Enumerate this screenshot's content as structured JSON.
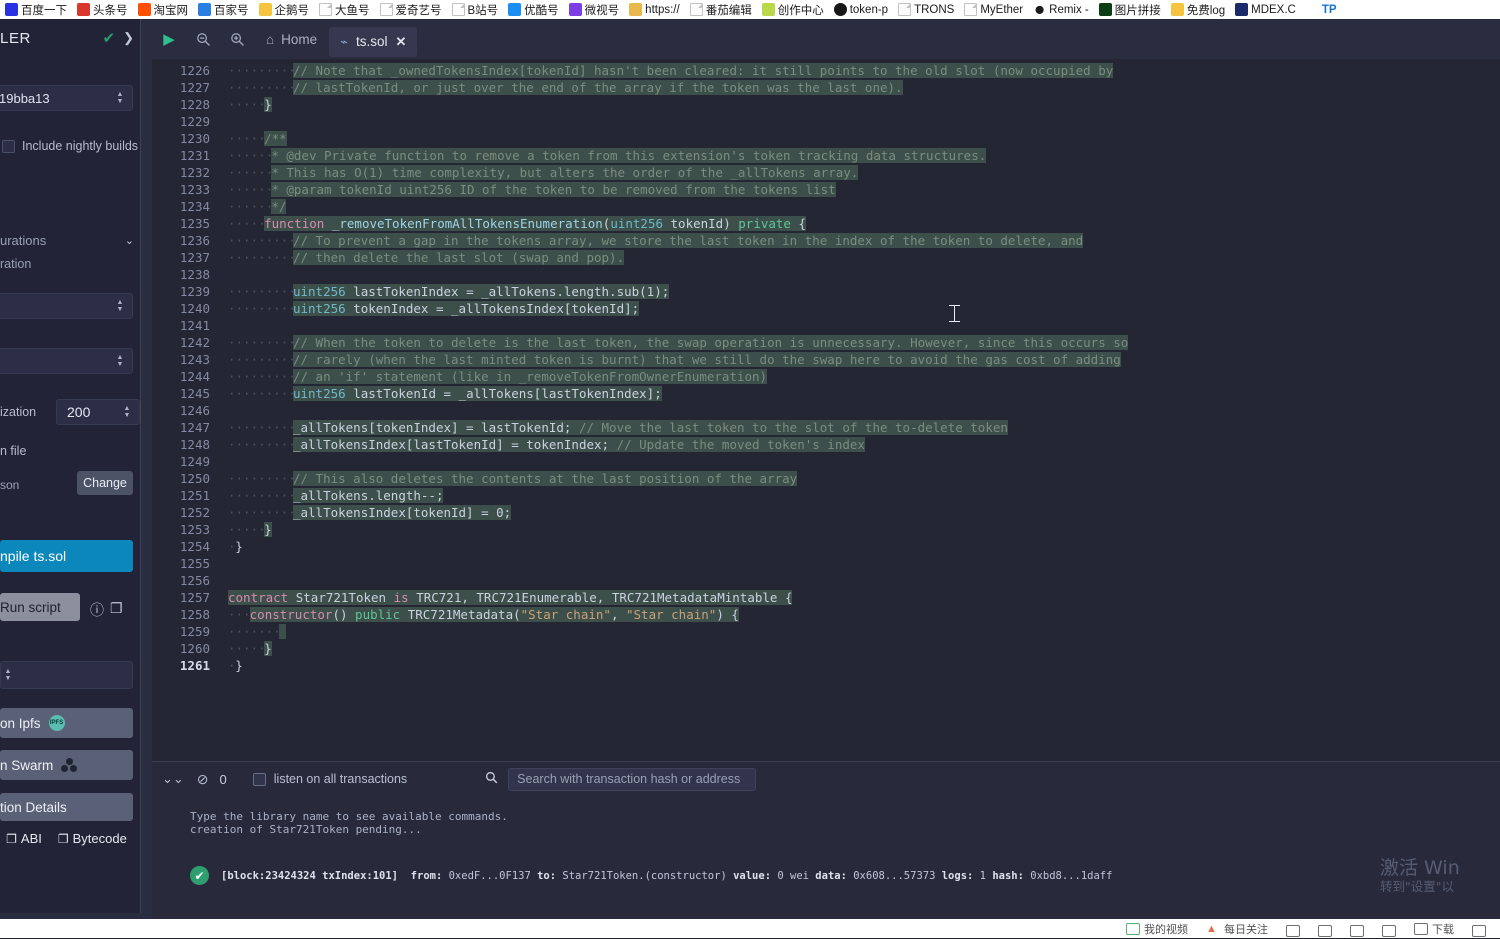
{
  "browser": {
    "bookmarks": [
      {
        "label": "百度一下",
        "icon": "baidu-icon",
        "color": "#2932e1"
      },
      {
        "label": "头条号",
        "icon": "toutiao-icon",
        "color": "#d9372b"
      },
      {
        "label": "淘宝网",
        "icon": "taobao-icon",
        "color": "#ff5000"
      },
      {
        "label": "百家号",
        "icon": "baijiahao-icon",
        "color": "#2b7fe0"
      },
      {
        "label": "企鹅号",
        "icon": "qiehao-icon",
        "color": "#f5c542"
      },
      {
        "label": "大鱼号",
        "icon": "page-icon",
        "color": "#ffffff"
      },
      {
        "label": "爱奇艺号",
        "icon": "page-icon",
        "color": "#ffffff"
      },
      {
        "label": "B站号",
        "icon": "page-icon",
        "color": "#ffffff"
      },
      {
        "label": "优酷号",
        "icon": "youku-icon",
        "color": "#1b8ef2"
      },
      {
        "label": "微视号",
        "icon": "weishi-icon",
        "color": "#7b3fe4"
      },
      {
        "label": "https://",
        "icon": "folder-icon",
        "color": "#e8b84b"
      },
      {
        "label": "番茄编辑",
        "icon": "page-icon",
        "color": "#ffffff"
      },
      {
        "label": "创作中心",
        "icon": "creation-icon",
        "color": "#b9d94b"
      },
      {
        "label": "token-p",
        "icon": "github-icon",
        "color": "#181717"
      },
      {
        "label": "TRONS",
        "icon": "page-icon",
        "color": "#ffffff"
      },
      {
        "label": "MyEther",
        "icon": "page-icon",
        "color": "#ffffff"
      },
      {
        "label": "Remix -",
        "icon": "remix-icon",
        "color": "#2a2a2a"
      },
      {
        "label": "图片拼接",
        "icon": "green-square-icon",
        "color": "#0d3d14"
      },
      {
        "label": "免费log",
        "icon": "logo-icon",
        "color": "#f5c542"
      },
      {
        "label": "MDEX.C",
        "icon": "mdex-icon",
        "color": "#1b2a6b"
      },
      {
        "label": "TP",
        "icon": "tp-icon",
        "color": "#1673d1"
      }
    ]
  },
  "compiler_panel": {
    "title": "LER",
    "status_check": "✔",
    "chevron": "❯",
    "version_value": "19bba13",
    "nightly_label": "Include nightly builds",
    "advanced_label": "urations",
    "advanced_sub": "ration",
    "optimization_label": "ization",
    "optimization_runs": "200",
    "config_file_label": "n file",
    "config_file_name": "son",
    "change_label": "Change",
    "compile_label": "npile ts.sol",
    "run_script_label": "Run script",
    "info_icon": "ⓘ",
    "copy_icon": "❐",
    "publish_ipfs_label": "on Ipfs",
    "publish_swarm_label": "n Swarm",
    "details_label": "tion Details",
    "abi_label": "ABI",
    "bytecode_label": "Bytecode",
    "expand_chevron": "❯"
  },
  "editor": {
    "run_icon": "▶",
    "zoom_out_icon": "zoom-out-icon",
    "zoom_in_icon": "zoom-in-icon",
    "home_label": "Home",
    "home_icon": "⌂",
    "tab_label": "ts.sol",
    "tab_close": "✕",
    "first_line": 1226,
    "active_line": 1261,
    "lines": [
      {
        "n": 1226,
        "indent": 9,
        "html": "<span class=\"selbg cm\">// Note that _ownedTokensIndex[tokenId] hasn't been cleared: it still points to the old slot (now occupied by</span>"
      },
      {
        "n": 1227,
        "indent": 9,
        "html": "<span class=\"selbg cm\">// lastTokenId, or just over the end of the array if the token was the last one).</span>"
      },
      {
        "n": 1228,
        "indent": 5,
        "html": "<span class=\"selbg pl\">}</span>"
      },
      {
        "n": 1229,
        "indent": 0,
        "html": ""
      },
      {
        "n": 1230,
        "indent": 5,
        "html": "<span class=\"selbg cm\">/**</span>"
      },
      {
        "n": 1231,
        "indent": 6,
        "html": "<span class=\"selbg cm\">* @dev Private function to remove a token from this extension's token tracking data structures.</span>"
      },
      {
        "n": 1232,
        "indent": 6,
        "html": "<span class=\"selbg cm\">* This has O(1) time complexity, but alters the order of the _allTokens array.</span>"
      },
      {
        "n": 1233,
        "indent": 6,
        "html": "<span class=\"selbg cm\">* @param tokenId uint256 ID of the token to be removed from the tokens list</span>"
      },
      {
        "n": 1234,
        "indent": 6,
        "html": "<span class=\"selbg cm\">*/</span>"
      },
      {
        "n": 1235,
        "indent": 5,
        "html": "<span class=\"selbg\"><span class=\"kw\">function</span> <span class=\"fn\">_removeTokenFromAllTokensEnumeration</span><span class=\"pl\">(</span><span class=\"ty\">uint256</span> <span class=\"pl\">tokenId)</span> <span class=\"mod\">private</span> <span class=\"pl\">{</span></span>"
      },
      {
        "n": 1236,
        "indent": 9,
        "html": "<span class=\"selbg cm\">// To prevent a gap in the tokens array, we store the last token in the index of the token to delete, and</span>"
      },
      {
        "n": 1237,
        "indent": 9,
        "html": "<span class=\"selbg cm\">// then delete the last slot (swap and pop).</span>"
      },
      {
        "n": 1238,
        "indent": 0,
        "html": ""
      },
      {
        "n": 1239,
        "indent": 9,
        "html": "<span class=\"selbg\"><span class=\"ty\">uint256</span> <span class=\"pl\">lastTokenIndex = _allTokens.length.sub(1);</span></span>"
      },
      {
        "n": 1240,
        "indent": 9,
        "html": "<span class=\"selbg\"><span class=\"ty\">uint256</span> <span class=\"pl\">tokenIndex = _allTokensIndex[tokenId];</span></span>"
      },
      {
        "n": 1241,
        "indent": 0,
        "html": ""
      },
      {
        "n": 1242,
        "indent": 9,
        "html": "<span class=\"selbg cm\">// When the token to delete is the last token, the swap operation is unnecessary. However, since this occurs so</span>"
      },
      {
        "n": 1243,
        "indent": 9,
        "html": "<span class=\"selbg cm\">// rarely (when the last minted token is burnt) that we still do the swap here to avoid the gas cost of adding</span>"
      },
      {
        "n": 1244,
        "indent": 9,
        "html": "<span class=\"selbg cm\">// an 'if' statement (like in _removeTokenFromOwnerEnumeration)</span>"
      },
      {
        "n": 1245,
        "indent": 9,
        "html": "<span class=\"selbg\"><span class=\"ty\">uint256</span> <span class=\"pl\">lastTokenId = _allTokens[lastTokenIndex];</span></span>"
      },
      {
        "n": 1246,
        "indent": 0,
        "html": ""
      },
      {
        "n": 1247,
        "indent": 9,
        "html": "<span class=\"selbg\"><span class=\"pl\">_allTokens[tokenIndex] = lastTokenId;</span> <span class=\"cm\">// Move the last token to the slot of the to-delete token</span></span>"
      },
      {
        "n": 1248,
        "indent": 9,
        "html": "<span class=\"selbg\"><span class=\"pl\">_allTokensIndex[lastTokenId] = tokenIndex;</span> <span class=\"cm\">// Update the moved token's index</span></span>"
      },
      {
        "n": 1249,
        "indent": 0,
        "html": ""
      },
      {
        "n": 1250,
        "indent": 9,
        "html": "<span class=\"selbg cm\">// This also deletes the contents at the last position of the array</span>"
      },
      {
        "n": 1251,
        "indent": 9,
        "html": "<span class=\"selbg pl\">_allTokens.length--;</span>"
      },
      {
        "n": 1252,
        "indent": 9,
        "html": "<span class=\"selbg pl\">_allTokensIndex[tokenId] = 0;</span>"
      },
      {
        "n": 1253,
        "indent": 5,
        "html": "<span class=\"selbg pl\">}</span>"
      },
      {
        "n": 1254,
        "indent": 1,
        "html": "<span class=\"pl\">}</span>"
      },
      {
        "n": 1255,
        "indent": 0,
        "html": ""
      },
      {
        "n": 1256,
        "indent": 0,
        "html": ""
      },
      {
        "n": 1257,
        "indent": 0,
        "html": "<span class=\"selbg\"><span class=\"kw\">contract</span> <span class=\"pl\">Star721Token</span> <span class=\"kw\">is</span> <span class=\"pl\">TRC721, TRC721Enumerable, TRC721MetadataMintable {</span></span>"
      },
      {
        "n": 1258,
        "indent": 3,
        "html": "<span class=\"selbg\"><span class=\"kw\">constructor</span><span class=\"pl\">()</span> <span class=\"mod\">public</span> <span class=\"pl\">TRC721Metadata(</span><span class=\"str\">\"Star chain\"</span><span class=\"pl\">, </span><span class=\"str\">\"Star chain\"</span><span class=\"pl\">) {</span></span>"
      },
      {
        "n": 1259,
        "indent": 7,
        "html": "<span class=\"selbg\"> </span>"
      },
      {
        "n": 1260,
        "indent": 5,
        "html": "<span class=\"selbg pl\">}</span>"
      },
      {
        "n": 1261,
        "indent": 1,
        "html": "<span class=\"pl\">}</span>"
      }
    ]
  },
  "terminal": {
    "chevrons_icon": "⌄⌄",
    "ban_icon": "⊘",
    "count": "0",
    "listen_label": "listen on all transactions",
    "search_icon": "search-icon",
    "search_placeholder": "Search with transaction hash or address",
    "log_lines": [
      "Type the library name to see available commands.",
      "creation of Star721Token pending..."
    ],
    "transaction": {
      "status_icon": "✔",
      "block_label": "[block:23424324 txIndex:101]",
      "from_key": "from:",
      "from_value": "0xedF...0F137",
      "to_key": "to:",
      "to_value": "Star721Token.(constructor)",
      "value_key": "value:",
      "value_value": "0 wei",
      "data_key": "data:",
      "data_value": "0x608...57373",
      "logs_key": "logs:",
      "logs_value": "1",
      "hash_key": "hash:",
      "hash_value": "0xbd8...1daff"
    }
  },
  "watermark": {
    "line1": "激活 Win",
    "line2": "转到\"设置\"以"
  },
  "bottom_strip": {
    "items": [
      {
        "label": "我的视频",
        "icon": "video-icon"
      },
      {
        "label": "每日关注",
        "icon": "flame-icon"
      },
      {
        "label": "",
        "icon": "screenshot-icon"
      },
      {
        "label": "",
        "icon": "image-icon"
      },
      {
        "label": "",
        "icon": "cloud-icon"
      },
      {
        "label": "",
        "icon": "link-icon"
      },
      {
        "label": "下载",
        "icon": "download-icon"
      },
      {
        "label": "",
        "icon": "window-icon"
      }
    ]
  },
  "colors": {
    "accent_blue": "#0c87bb",
    "success_green": "#2f9e6e",
    "editor_bg": "#242633",
    "panel_bg": "#222336",
    "selection": "#3c4f4a"
  }
}
